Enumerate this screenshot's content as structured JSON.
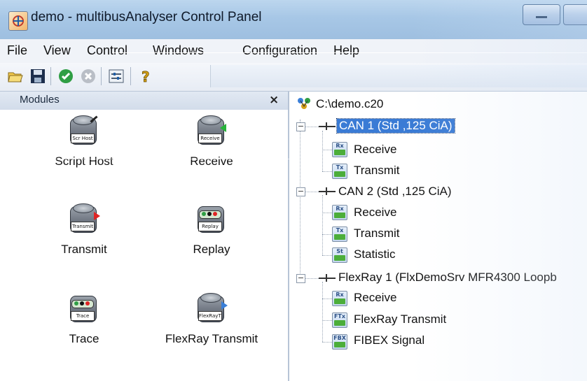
{
  "window": {
    "title": "demo - multibusAnalyser Control Panel"
  },
  "menu": [
    "File",
    "View",
    "Control",
    "Windows",
    "Configuration",
    "Help"
  ],
  "toolbar": {
    "buttons": [
      "open-folder-icon",
      "save-disk-icon",
      "check-icon",
      "stop-icon",
      "settings-panel-icon",
      "help-icon"
    ]
  },
  "modules": {
    "title": "Modules",
    "close": "×",
    "items": [
      {
        "label": "Script Host",
        "badge": "Scr Host"
      },
      {
        "label": "Receive",
        "badge": "Receive"
      },
      {
        "label": "Transmit",
        "badge": "Transmit"
      },
      {
        "label": "Replay",
        "badge": "Replay"
      },
      {
        "label": "Trace",
        "badge": "Trace"
      },
      {
        "label": "FlexRay Transmit",
        "badge": "FlexRayTx"
      }
    ]
  },
  "tree": {
    "root": "C:\\demo.c20",
    "nodes": [
      {
        "label": "CAN 1 (Std ,125 CiA)",
        "selected": true,
        "children": [
          {
            "label": "Receive",
            "icon": "Rx"
          },
          {
            "label": "Transmit",
            "icon": "Tx"
          }
        ]
      },
      {
        "label": "CAN 2 (Std ,125 CiA)",
        "children": [
          {
            "label": "Receive",
            "icon": "Rx"
          },
          {
            "label": "Transmit",
            "icon": "Tx"
          },
          {
            "label": "Statistic",
            "icon": "St"
          }
        ]
      },
      {
        "label": "FlexRay 1 (FlxDemoSrv MFR4300 Loopb",
        "children": [
          {
            "label": "Receive",
            "icon": "Rx"
          },
          {
            "label": "FlexRay Transmit",
            "icon": "FTx"
          },
          {
            "label": "FIBEX Signal",
            "icon": "FBX"
          }
        ]
      }
    ]
  },
  "colors": {
    "selection": "#3a7bd5",
    "titlebar": "#a7c7e6"
  }
}
